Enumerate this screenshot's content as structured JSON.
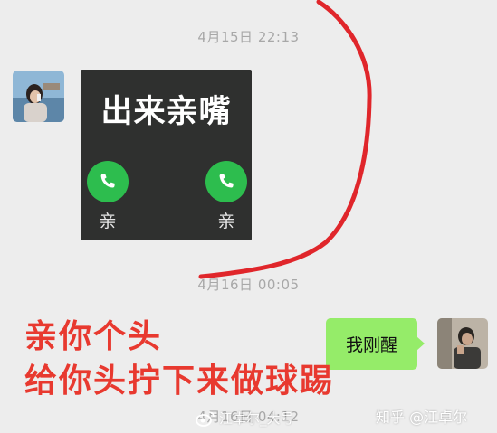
{
  "chat": {
    "timestamp_1": "4月15日 22:13",
    "timestamp_2": "4月16日 00:05",
    "timestamp_3": "4月16日 04:12"
  },
  "sticker": {
    "title": "出来亲嘴",
    "left_call_label": "亲",
    "right_call_label": "亲"
  },
  "reply_bubble": {
    "text": "我刚醒"
  },
  "caption": {
    "line_1": "亲你个头",
    "line_2": "给你头拧下来做球踢"
  },
  "watermarks": {
    "zhihu": "知乎 @江卓尔",
    "weibo": "江卓尔_大号"
  },
  "colors": {
    "chat_background": "#ededed",
    "sticker_background": "#2f302f",
    "call_button_green": "#2dbd4e",
    "bubble_green": "#95ec69",
    "caption_red": "#e8392f",
    "annotation_line_red": "#e0262b"
  }
}
